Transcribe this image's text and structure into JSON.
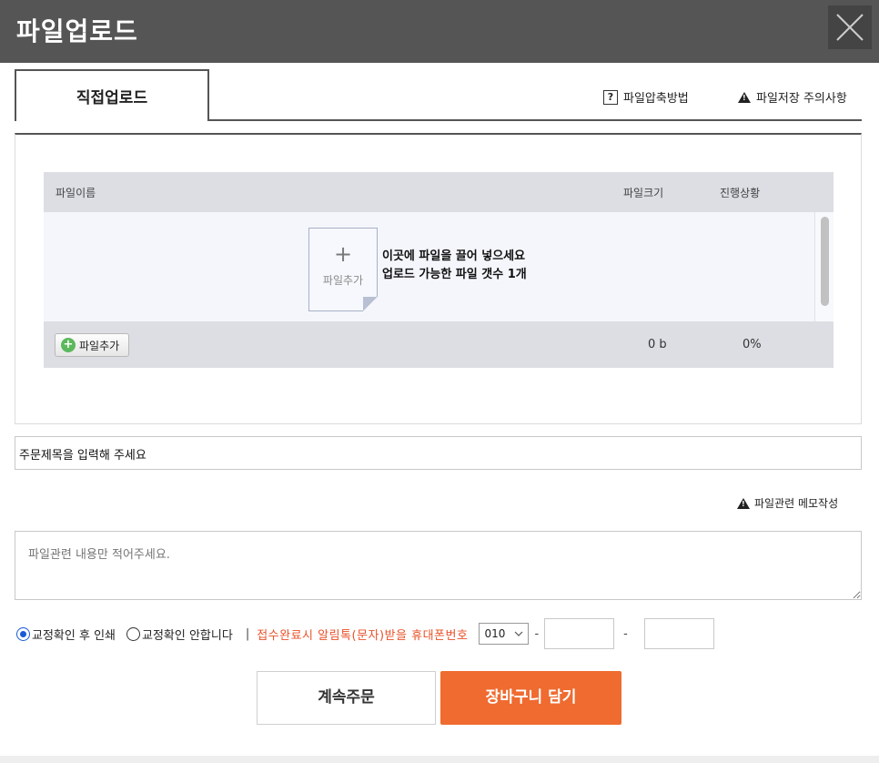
{
  "window": {
    "title": "파일업로드",
    "close_icon": "close-icon"
  },
  "tabs": {
    "active_label": "직접업로드"
  },
  "links": {
    "compress_help": "파일압축방법",
    "save_caution": "파일저장 주의사항",
    "memo_link": "파일관련 메모작성"
  },
  "file_table": {
    "headers": {
      "name": "파일이름",
      "size": "파일크기",
      "progress": "진행상황"
    },
    "drop_icon_label": "파일추가",
    "drop_line1": "이곳에 파일을 끌어 넣으세요",
    "drop_line2_prefix": "업로드 가능한 파일 갯수 ",
    "drop_line2_count": "1개",
    "add_button_label": "파일추가",
    "total_size": "0 b",
    "total_progress": "0%"
  },
  "order_title": {
    "value": "주문제목을 입력해 주세요"
  },
  "memo": {
    "placeholder": "파일관련 내용만 적어주세요."
  },
  "options": {
    "proof_print": "교정확인 후 인쇄",
    "proof_skip": "교정확인 안합니다",
    "selected": "proof_print",
    "separator": "|",
    "notify_label": "접수완료시 알림톡(문자)받을 휴대폰번호",
    "phone_prefix": "010",
    "dash": "-"
  },
  "buttons": {
    "continue": "계속주문",
    "add_to_cart": "장바구니 담기"
  },
  "colors": {
    "titlebar": "#555555",
    "accent_orange": "#ef6b30",
    "notify_text": "#e8532a",
    "radio_selected": "#1a5ad7"
  }
}
